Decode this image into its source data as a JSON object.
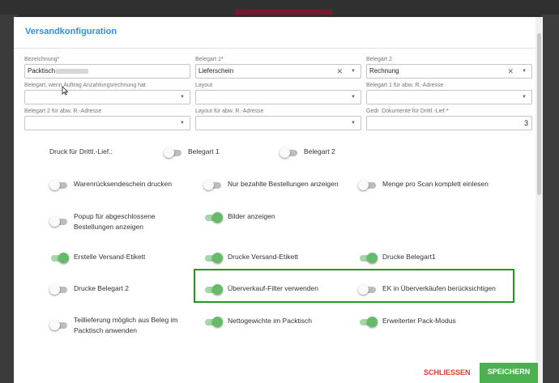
{
  "dialog": {
    "title": "Versandkonfiguration",
    "fields": {
      "bezeichnung": {
        "label": "Bezeichnung",
        "required": "*",
        "value": "Packtisch"
      },
      "belegart1": {
        "label": "Belegart 1",
        "required": "*",
        "value": "Lieferschein"
      },
      "belegart2": {
        "label": "Belegart 2",
        "value": "Rechnung"
      },
      "belegart_anzahlung": {
        "label": "Belegart, wenn Auftrag Anzahlungsrechnung hat",
        "value": ""
      },
      "layout": {
        "label": "Layout",
        "value": ""
      },
      "belegart1_abw": {
        "label": "Belegart 1 für abw. R.-Adresse",
        "value": ""
      },
      "belegart2_abw": {
        "label": "Belegart 2 für abw. R.-Adresse",
        "value": ""
      },
      "layout_abw": {
        "label": "Layout für abw. R.-Adresse",
        "value": ""
      },
      "gedr_dokumente": {
        "label": "Gedr. Dokumente für Drittl.-Lief.",
        "required": "*",
        "value": "3"
      }
    },
    "druck_label": "Druck für Drittl.-Lief.:",
    "toggles": {
      "druck_belegart1": {
        "label": "Belegart 1",
        "on": false
      },
      "druck_belegart2": {
        "label": "Belegart 2",
        "on": false
      },
      "warenruecksendeschein": {
        "label": "Warenrücksendeschein drucken",
        "on": false
      },
      "nur_bezahlte": {
        "label": "Nur bezahlte Bestellungen anzeigen",
        "on": false
      },
      "menge_pro_scan": {
        "label": "Menge pro Scan komplett einlesen",
        "on": false
      },
      "popup_abgeschlossen": {
        "label": "Popup für abgeschlossene Bestellungen anzeigen",
        "on": false
      },
      "bilder_anzeigen": {
        "label": "Bilder anzeigen",
        "on": true
      },
      "erstelle_versand_etikett": {
        "label": "Erstelle Versand-Etikett",
        "on": true
      },
      "drucke_versand_etikett": {
        "label": "Drucke Versand-Etikett",
        "on": true
      },
      "drucke_belegart1": {
        "label": "Drucke Belegart1",
        "on": true
      },
      "drucke_belegart2": {
        "label": "Drucke Belegart 2",
        "on": false
      },
      "ueberverkauf_filter": {
        "label": "Überverkauf-Filter verwenden",
        "on": true
      },
      "ek_ueberverkaeufe": {
        "label": "EK in Überverkäufen berücksichtigen",
        "on": false
      },
      "teillieferung": {
        "label": "Teillieferung möglich aus Beleg im Packtisch anwenden",
        "on": false
      },
      "nettogewichte": {
        "label": "Nettogewichte im Packtisch",
        "on": true
      },
      "erweiterter_pack_modus": {
        "label": "Erweiterter Pack-Modus",
        "on": true
      }
    },
    "buttons": {
      "close": "SCHLIESSEN",
      "save": "SPEICHERN"
    }
  },
  "colors": {
    "accent": "#2f8fe3",
    "toggle_on": "#66bb6a",
    "highlight_box": "#1e9a1e",
    "danger": "#e53935",
    "save": "#4caf50"
  }
}
